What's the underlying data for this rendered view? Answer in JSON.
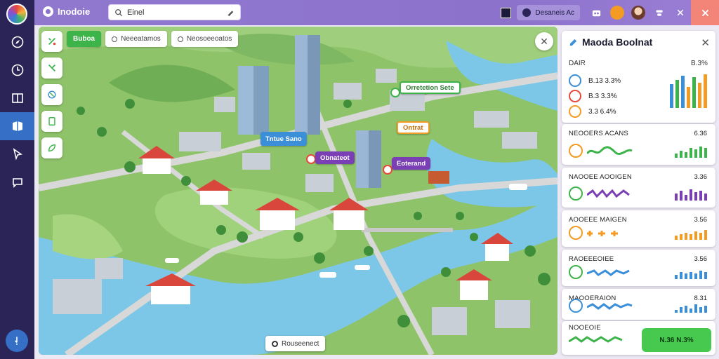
{
  "app": {
    "name": "Inodoie"
  },
  "search": {
    "value": "Einel"
  },
  "topbar": {
    "user_label": "Desaneis Ac"
  },
  "map": {
    "chips": [
      "Buboa",
      "Neeeatamos",
      "Neosoeeoatos"
    ],
    "pins": [
      {
        "label": "Orretetion Sete",
        "color": "#3db44a"
      },
      {
        "label": "Ontrat",
        "color": "#f39b23"
      },
      {
        "label": "Tntue Sano",
        "color": "#3a8fd8"
      },
      {
        "label": "Obnateot",
        "color": "#7b3fb5"
      },
      {
        "label": "Eoterand",
        "color": "#7b3fb5"
      }
    ],
    "footer_label": "Rouseenect"
  },
  "panel": {
    "title": "Maoda Boolnat",
    "subtitle": "DAIR",
    "subtitle_value": "B.3%",
    "rows": [
      {
        "value": "B.13 3.3%",
        "color": "#3a8fd8"
      },
      {
        "value": "B.3 3.3%",
        "color": "#e8493b"
      },
      {
        "value": "3.3 6.4%",
        "color": "#f39b23"
      }
    ],
    "metrics": [
      {
        "title": "NEOOERS ACANS",
        "value": "6.36",
        "color": "#f39b23",
        "spark_color": "#3db44a"
      },
      {
        "title": "NAOOEE AOOIGEN",
        "value": "3.36",
        "color": "#3db44a",
        "spark_color": "#7b3fb5"
      },
      {
        "title": "AOOEEE MAIGEN",
        "value": "3.56",
        "color": "#f39b23",
        "spark_color": "#f39b23"
      },
      {
        "title": "RAOEEEOIEE",
        "value": "3.56",
        "color": "#3db44a",
        "spark_color": "#3a8fd8"
      },
      {
        "title": "MAOOERAION",
        "value": "8.31",
        "color": "#3a8fd8",
        "spark_color": "#3a8fd8"
      },
      {
        "title": "NOOEOIE",
        "value": "",
        "color": "#3db44a",
        "spark_color": "#3db44a"
      }
    ],
    "action_label": "N.36 N.3%"
  },
  "colors": {
    "rail": "#2b2457",
    "topbar": "#8d72cc",
    "accent_blue": "#3570c6",
    "green": "#3db44a",
    "water": "#7cc7e8"
  }
}
